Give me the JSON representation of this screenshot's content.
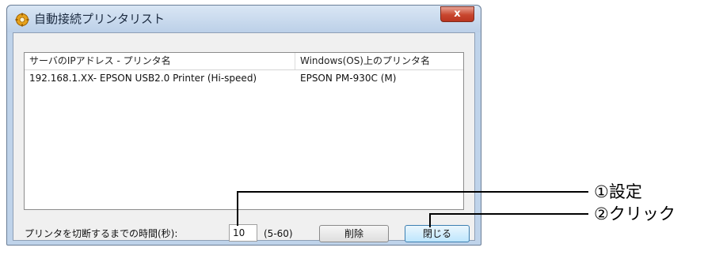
{
  "window": {
    "title": "自動接続プリンタリスト",
    "close_glyph": "x",
    "icon": "printer-gear-icon"
  },
  "list": {
    "columns": [
      "サーバのIPアドレス - プリンタ名",
      "Windows(OS)上のプリンタ名"
    ],
    "rows": [
      [
        "192.168.1.XX- EPSON USB2.0 Printer (Hi-speed)",
        "EPSON PM-930C (M)"
      ]
    ]
  },
  "timeout": {
    "label": "プリンタを切断するまでの時間(秒):",
    "value": "10",
    "range": "(5-60)"
  },
  "buttons": {
    "delete": "削除",
    "close": "閉じる"
  },
  "callouts": {
    "setting": "①設定",
    "click": "②クリック"
  }
}
